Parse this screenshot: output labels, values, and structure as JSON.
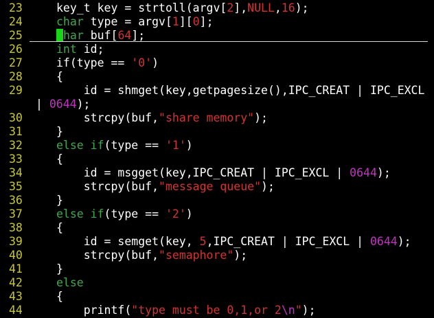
{
  "editor": {
    "colors": {
      "line_number": "#c8c832",
      "keyword": "#3ea84e",
      "string": "#d23434",
      "number": "#c232c2",
      "cursor": "#19d419",
      "background": "#000000",
      "text": "#ffffff"
    },
    "lines": [
      {
        "n": "23",
        "tokens": [
          {
            "t": "key_t key = strtoll(argv["
          },
          {
            "t": "2",
            "c": "str"
          },
          {
            "t": "],"
          },
          {
            "t": "NULL",
            "c": "str"
          },
          {
            "t": ","
          },
          {
            "t": "16",
            "c": "str"
          },
          {
            "t": ");"
          }
        ]
      },
      {
        "n": "24",
        "tokens": [
          {
            "t": "char",
            "c": "kw"
          },
          {
            "t": " type = argv["
          },
          {
            "t": "1",
            "c": "str"
          },
          {
            "t": "]["
          },
          {
            "t": "0",
            "c": "str"
          },
          {
            "t": "];"
          }
        ]
      },
      {
        "n": "25",
        "tokens": [
          {
            "t": "char",
            "c": "kw",
            "cursor": true
          },
          {
            "t": " buf["
          },
          {
            "t": "64",
            "c": "str"
          },
          {
            "t": "];"
          }
        ]
      },
      {
        "n": "26",
        "tokens": [
          {
            "t": "int",
            "c": "kw"
          },
          {
            "t": " id;"
          }
        ]
      },
      {
        "n": "27",
        "tokens": [
          {
            "t": "if(type == "
          },
          {
            "t": "'0'",
            "c": "str"
          },
          {
            "t": ")"
          }
        ]
      },
      {
        "n": "28",
        "tokens": [
          {
            "t": "{"
          }
        ]
      },
      {
        "n": "29",
        "tokens": [
          {
            "t": "    id = shmget(key,getpagesize(),IPC_CREAT | IPC_EXCL"
          }
        ]
      },
      {
        "n": "",
        "wrap": true,
        "tokens": [
          {
            "t": "| "
          },
          {
            "t": "0644",
            "c": "num2"
          },
          {
            "t": ");"
          }
        ]
      },
      {
        "n": "30",
        "tokens": [
          {
            "t": "    strcpy(buf,"
          },
          {
            "t": "\"share memory\"",
            "c": "str"
          },
          {
            "t": ");"
          }
        ]
      },
      {
        "n": "31",
        "tokens": [
          {
            "t": "}"
          }
        ]
      },
      {
        "n": "32",
        "tokens": [
          {
            "t": "else if",
            "c": "kw"
          },
          {
            "t": "(type == "
          },
          {
            "t": "'1'",
            "c": "str"
          },
          {
            "t": ")"
          }
        ]
      },
      {
        "n": "33",
        "tokens": [
          {
            "t": "{"
          }
        ]
      },
      {
        "n": "34",
        "tokens": [
          {
            "t": "    id = msgget(key,IPC_CREAT | IPC_EXCL | "
          },
          {
            "t": "0644",
            "c": "num2"
          },
          {
            "t": ");"
          }
        ]
      },
      {
        "n": "35",
        "tokens": [
          {
            "t": "    strcpy(buf,"
          },
          {
            "t": "\"message queue\"",
            "c": "str"
          },
          {
            "t": ");"
          }
        ]
      },
      {
        "n": "36",
        "tokens": [
          {
            "t": "}"
          }
        ]
      },
      {
        "n": "37",
        "tokens": [
          {
            "t": "else if",
            "c": "kw"
          },
          {
            "t": "(type == "
          },
          {
            "t": "'2'",
            "c": "str"
          },
          {
            "t": ")"
          }
        ]
      },
      {
        "n": "38",
        "tokens": [
          {
            "t": "{"
          }
        ]
      },
      {
        "n": "39",
        "tokens": [
          {
            "t": "    id = semget(key, "
          },
          {
            "t": "5",
            "c": "str"
          },
          {
            "t": ",IPC_CREAT | IPC_EXCL | "
          },
          {
            "t": "0644",
            "c": "num2"
          },
          {
            "t": ");"
          }
        ]
      },
      {
        "n": "40",
        "tokens": [
          {
            "t": "    strcpy(buf,"
          },
          {
            "t": "\"semaphore\"",
            "c": "str"
          },
          {
            "t": ");"
          }
        ]
      },
      {
        "n": "41",
        "tokens": [
          {
            "t": "}"
          }
        ]
      },
      {
        "n": "42",
        "tokens": [
          {
            "t": "else",
            "c": "kw"
          }
        ]
      },
      {
        "n": "43",
        "tokens": [
          {
            "t": "{"
          }
        ]
      },
      {
        "n": "44",
        "tokens": [
          {
            "t": "    printf("
          },
          {
            "t": "\"type must be 0,1,or 2",
            "c": "str"
          },
          {
            "t": "\\n",
            "c": "esc"
          },
          {
            "t": "\"",
            "c": "str"
          },
          {
            "t": ");"
          }
        ]
      }
    ]
  }
}
